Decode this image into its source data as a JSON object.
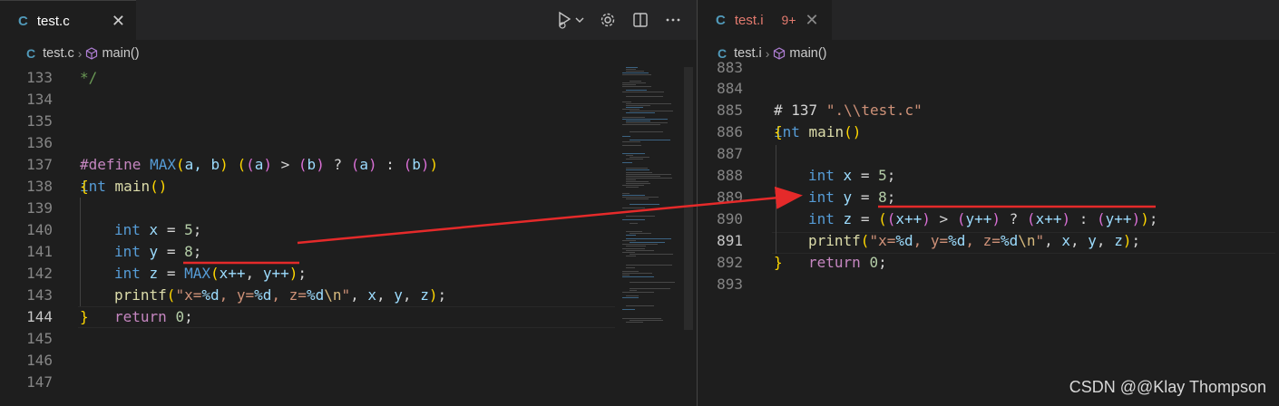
{
  "left_editor": {
    "tab": {
      "lang_icon": "C",
      "name": "test.c",
      "close": "✕"
    },
    "breadcrumb": {
      "lang_icon": "C",
      "file": "test.c",
      "symbol": "main()"
    },
    "actions": [
      "run-debug-icon",
      "gear-icon",
      "split-editor-icon",
      "more-actions-icon"
    ],
    "lines": [
      {
        "n": "133"
      },
      {
        "n": "134"
      },
      {
        "n": "135"
      },
      {
        "n": "136"
      },
      {
        "n": "137"
      },
      {
        "n": "138"
      },
      {
        "n": "139"
      },
      {
        "n": "140"
      },
      {
        "n": "141"
      },
      {
        "n": "142"
      },
      {
        "n": "143"
      },
      {
        "n": "144",
        "active": true
      },
      {
        "n": "145"
      },
      {
        "n": "146"
      },
      {
        "n": "147"
      }
    ],
    "code": {
      "l133": "*/",
      "l136_define": "#define",
      "l136_max": "MAX",
      "l136_params": "a, b",
      "l137_int": "int",
      "l137_main": "main",
      "int": "int",
      "x": "x",
      "y": "y",
      "z": "z",
      "five": "5",
      "eight": "8",
      "max": "MAX",
      "xpp": "x++",
      "ypp": "y++",
      "printf": "printf",
      "fmt_a": "\"x=",
      "fmt_b": "%d",
      "fmt_c": ", y=",
      "fmt_d": ", z=",
      "fmt_e": "\\n",
      "fmt_f": "\"",
      "return": "return",
      "zero": "0"
    }
  },
  "right_editor": {
    "tab": {
      "lang_icon": "C",
      "name": "test.i",
      "badge": "9+",
      "close": "✕"
    },
    "breadcrumb": {
      "lang_icon": "C",
      "file": "test.i",
      "symbol": "main()"
    },
    "lines": [
      {
        "n": "883"
      },
      {
        "n": "884"
      },
      {
        "n": "885"
      },
      {
        "n": "886"
      },
      {
        "n": "887"
      },
      {
        "n": "888"
      },
      {
        "n": "889"
      },
      {
        "n": "890"
      },
      {
        "n": "891",
        "active": true
      },
      {
        "n": "892"
      },
      {
        "n": "893"
      }
    ],
    "code": {
      "l884_hash": "# 137",
      "l884_file": "\".\\\\test.c\""
    }
  },
  "watermark": "CSDN @@Klay Thompson",
  "colors": {
    "annotation_red": "#e52a2a",
    "accent_c": "#519aba"
  }
}
